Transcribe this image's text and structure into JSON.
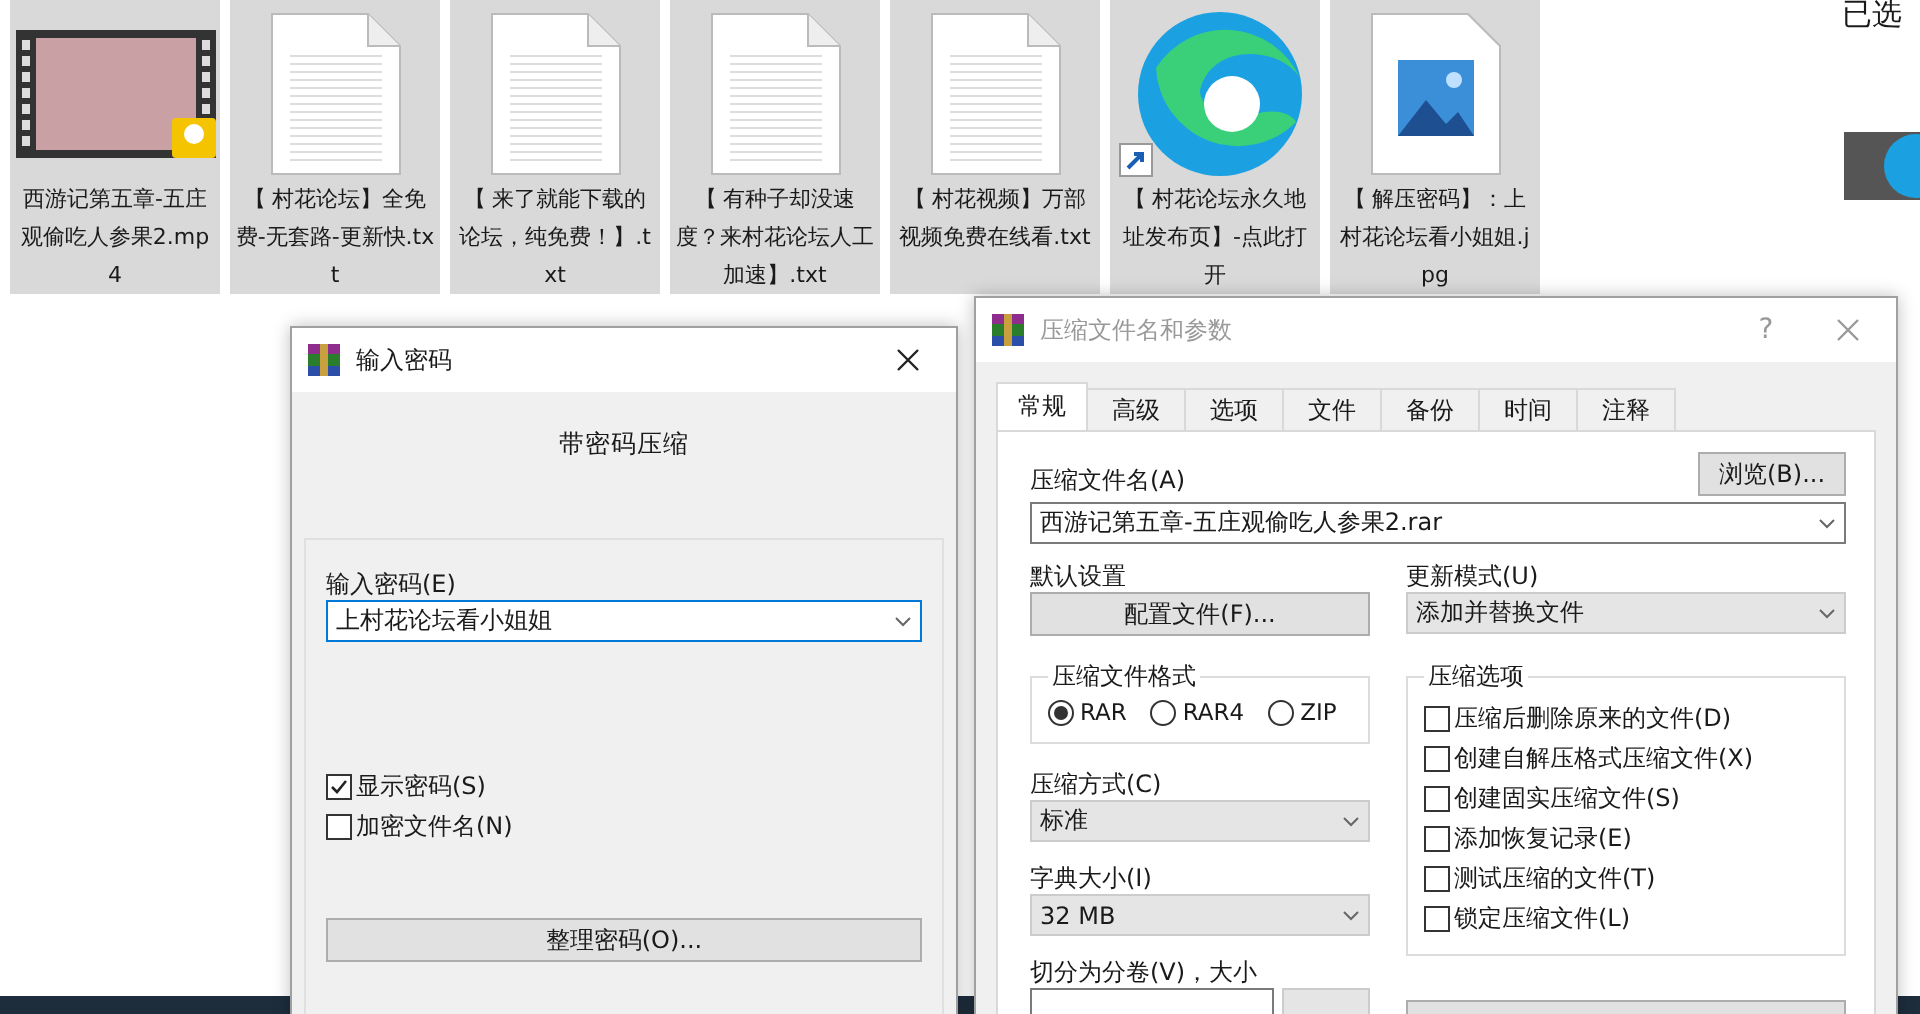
{
  "files": [
    {
      "kind": "video",
      "name": "西游记第五章-五庄观偷吃人参果2.mp4",
      "selected": true
    },
    {
      "kind": "text",
      "name": "【 村花论坛】全免费-无套路-更新快.txt",
      "selected": true
    },
    {
      "kind": "text",
      "name": "【 来了就能下载的论坛，纯免费！】.txt",
      "selected": true
    },
    {
      "kind": "text",
      "name": "【 有种子却没速度？来村花论坛人工加速】.txt",
      "selected": true
    },
    {
      "kind": "text",
      "name": "【 村花视频】万部视频免费在线看.txt",
      "selected": true
    },
    {
      "kind": "shortcut",
      "name": "【 村花论坛永久地址发布页】-点此打开",
      "selected": true
    },
    {
      "kind": "image",
      "name": "【 解压密码】：上村花论坛看小姐姐.jpg",
      "selected": true
    }
  ],
  "side_panel": {
    "heading": "已选"
  },
  "password_dialog": {
    "title": "输入密码",
    "subtitle": "带密码压缩",
    "field_label": "输入密码(E)",
    "password": "上村花论坛看小姐姐",
    "options": [
      {
        "label": "显示密码(S)",
        "checked": true
      },
      {
        "label": "加密文件名(N)",
        "checked": false
      }
    ],
    "organize_button": "整理密码(O)..."
  },
  "archive_dialog": {
    "title": "压缩文件名和参数",
    "help": "?",
    "tabs": [
      {
        "label": "常规",
        "selected": true
      },
      {
        "label": "高级",
        "selected": false
      },
      {
        "label": "选项",
        "selected": false
      },
      {
        "label": "文件",
        "selected": false
      },
      {
        "label": "备份",
        "selected": false
      },
      {
        "label": "时间",
        "selected": false
      },
      {
        "label": "注释",
        "selected": false
      }
    ],
    "archive_name_label": "压缩文件名(A)",
    "browse_button": "浏览(B)...",
    "archive_name": "西游记第五章-五庄观偷吃人参果2.rar",
    "defaults_label": "默认设置",
    "profiles_button": "配置文件(F)...",
    "update_mode_label": "更新模式(U)",
    "update_mode": "添加并替换文件",
    "format_group": "压缩文件格式",
    "formats": [
      {
        "label": "RAR",
        "selected": true
      },
      {
        "label": "RAR4",
        "selected": false
      },
      {
        "label": "ZIP",
        "selected": false
      }
    ],
    "method_label": "压缩方式(C)",
    "method": "标准",
    "dictionary_label": "字典大小(I)",
    "dictionary": "32 MB",
    "split_label": "切分为分卷(V)，大小",
    "options_group": "压缩选项",
    "options": [
      {
        "label": "压缩后删除原来的文件(D)",
        "checked": false
      },
      {
        "label": "创建自解压格式压缩文件(X)",
        "checked": false
      },
      {
        "label": "创建固实压缩文件(S)",
        "checked": false
      },
      {
        "label": "添加恢复记录(E)",
        "checked": false
      },
      {
        "label": "测试压缩的文件(T)",
        "checked": false
      },
      {
        "label": "锁定压缩文件(L)",
        "checked": false
      }
    ]
  }
}
